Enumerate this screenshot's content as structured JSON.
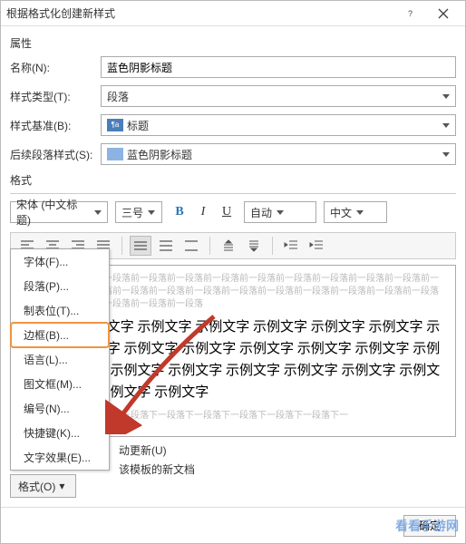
{
  "titlebar": {
    "title": "根据格式化创建新样式"
  },
  "section_props": "属性",
  "rows": {
    "name_label": "名称(N):",
    "name_value": "蓝色阴影标题",
    "type_label": "样式类型(T):",
    "type_value": "段落",
    "base_label": "样式基准(B):",
    "base_value": "标题",
    "follow_label": "后续段落样式(S):",
    "follow_value": "蓝色阴影标题"
  },
  "section_format": "格式",
  "toolbar": {
    "font": "宋体 (中文标题)",
    "size": "三号",
    "color_label": "自动",
    "lang": "中文"
  },
  "preview": {
    "before": "前一段落前一段落前一段落前一段落前一段落前一段落前一段落前一段落前一段落前一段落前一段落前一段落前一段落前一段落前一段落前一段落前一段落前一段落前一段落前一段落前一段落前一段落前一段落前一段落前一段落前一段落前一段落前一段落",
    "sample": "示例文字 示例文字 示例文字 示例文字 示例文字 示例文字 示例文字 示例文字 示例文字 示例文字 示例文字 示例文字 示例文字 示例文字 示例文字 示例文字 示例文字 示例文字 示例文字 示例文字 示例文字 示例文字 示例文字 示例文字 示例文字",
    "after": "段落下一段落下一段落下一段落下一段落下一段落下一段落下一段落下一段落下一"
  },
  "auto_update": "动更新(U)",
  "template_doc": "该模板的新文档",
  "format_button": "格式(O)",
  "menu": {
    "items": [
      "字体(F)...",
      "段落(P)...",
      "制表位(T)...",
      "边框(B)...",
      "语言(L)...",
      "图文框(M)...",
      "编号(N)...",
      "快捷键(K)...",
      "文字效果(E)..."
    ],
    "highlight_index": 3
  },
  "footer": {
    "ok": "确定"
  },
  "watermark": "看看手游网"
}
